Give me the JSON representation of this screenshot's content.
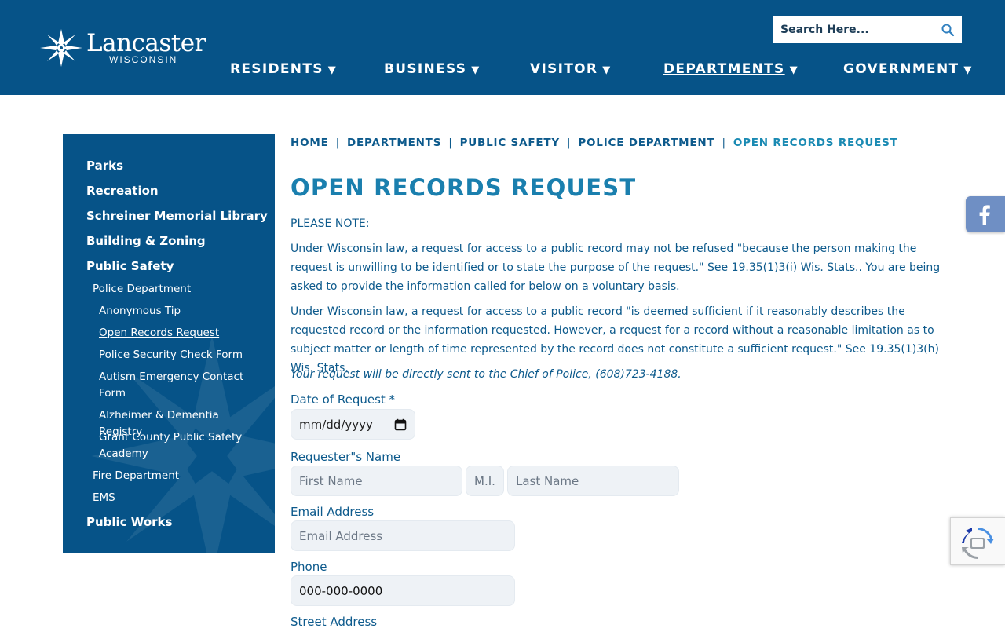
{
  "header": {
    "logo": {
      "name": "Lancaster",
      "subtitle": "WISCONSIN"
    },
    "search": {
      "placeholder": "Search Here..."
    },
    "nav": [
      {
        "label": "RESIDENTS"
      },
      {
        "label": "BUSINESS"
      },
      {
        "label": "VISITOR"
      },
      {
        "label": "DEPARTMENTS"
      },
      {
        "label": "GOVERNMENT"
      }
    ],
    "nav_caret": "▼"
  },
  "sidebar": {
    "items": [
      {
        "label": "Parks"
      },
      {
        "label": "Recreation"
      },
      {
        "label": "Schreiner Memorial Library"
      },
      {
        "label": "Building & Zoning"
      },
      {
        "label": "Public Safety"
      },
      {
        "label": "Police Department"
      },
      {
        "label": "Anonymous Tip"
      },
      {
        "label": "Open Records Request"
      },
      {
        "label": "Police Security Check Form"
      },
      {
        "label": "Autism Emergency Contact Form"
      },
      {
        "label": "Alzheimer & Dementia Registry"
      },
      {
        "label": "Grant County Public Safety Academy"
      },
      {
        "label": "Fire Department"
      },
      {
        "label": "EMS"
      },
      {
        "label": "Public Works"
      }
    ]
  },
  "breadcrumb": {
    "items": [
      "HOME",
      "DEPARTMENTS",
      "PUBLIC SAFETY",
      "POLICE DEPARTMENT",
      "OPEN RECORDS REQUEST"
    ],
    "separator": "|"
  },
  "main": {
    "title": "OPEN RECORDS REQUEST",
    "note_label": "PLEASE NOTE:",
    "paragraph1": "Under Wisconsin law, a request for access to a public record may not be refused \"because the person making the request is unwilling to be identified or to state the purpose of the request.\" See 19.35(1)3(i) Wis. Stats.. You are being asked to provide the information called for below on a voluntary basis.",
    "paragraph2": "Under Wisconsin law, a request for access to a public record \"is deemed sufficient if it reasonably describes the requested record or the information requested. However, a request for a record without a reasonable limitation as to subject matter or length of time represented by the record does not constitute a sufficient request.\" See 19.35(1)3(h) Wis. Stats.",
    "paragraph3": "Your request will be directly sent to the Chief of Police, (608)723-4188."
  },
  "form": {
    "date_label": "Date of Request *",
    "date_value": "mm/dd/yyyy",
    "name_label": "Requester\"s Name",
    "first_placeholder": "First Name",
    "mi_placeholder": "M.I.",
    "last_placeholder": "Last Name",
    "email_label": "Email Address",
    "email_placeholder": "Email Address",
    "phone_label": "Phone",
    "phone_value": "000-000-0000",
    "street_label": "Street Address"
  },
  "colors": {
    "brand_blue": "#065388",
    "link_blue": "#0d5a8c",
    "title_blue": "#1a7fae",
    "facebook_tab": "#6f8fc4"
  },
  "icons": {
    "search": "search-icon",
    "calendar": "calendar-icon",
    "facebook": "facebook-icon",
    "recaptcha": "recaptcha-icon"
  }
}
